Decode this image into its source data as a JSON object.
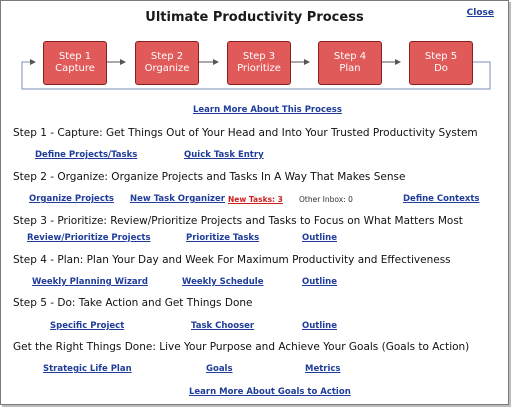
{
  "header": {
    "title": "Ultimate Productivity Process",
    "close_label": "Close"
  },
  "process_steps": [
    {
      "line1": "Step 1",
      "line2": "Capture"
    },
    {
      "line1": "Step 2",
      "line2": "Organize"
    },
    {
      "line1": "Step 3",
      "line2": "Prioritize"
    },
    {
      "line1": "Step 4",
      "line2": "Plan"
    },
    {
      "line1": "Step 5",
      "line2": "Do"
    }
  ],
  "learn_more_process": "Learn More About This Process",
  "sections": {
    "capture": {
      "heading": "Step 1 - Capture: Get Things Out of Your Head and Into Your Trusted Productivity System",
      "links": [
        "Define Projects/Tasks",
        "Quick Task Entry"
      ]
    },
    "organize": {
      "heading": "Step 2 - Organize: Organize Projects and Tasks In A Way That Makes Sense",
      "links": [
        "Organize Projects",
        "New Task Organizer",
        "New Tasks: 3",
        "Other Inbox: 0",
        "Define Contexts"
      ]
    },
    "prioritize": {
      "heading": "Step 3 - Prioritize: Review/Prioritize Projects and Tasks to Focus on What Matters Most",
      "links": [
        "Review/Prioritize Projects",
        "Prioritize Tasks",
        "Outline"
      ]
    },
    "plan": {
      "heading": "Step 4 - Plan: Plan Your Day and Week For Maximum Productivity and Effectiveness",
      "links": [
        "Weekly Planning Wizard",
        "Weekly Schedule",
        "Outline"
      ]
    },
    "do": {
      "heading": "Step 5 - Do: Take Action and Get Things Done",
      "links": [
        "Specific Project",
        "Task Chooser",
        "Outline"
      ]
    },
    "goals": {
      "heading": "Get the Right Things Done: Live Your Purpose and Achieve Your Goals (Goals to Action)",
      "links": [
        "Strategic Life Plan",
        "Goals",
        "Metrics"
      ]
    }
  },
  "learn_more_goals": "Learn More About Goals to Action",
  "colors": {
    "step_fill": "#e15a5a",
    "link": "#1f3d99",
    "alert": "#cc1f1f"
  }
}
